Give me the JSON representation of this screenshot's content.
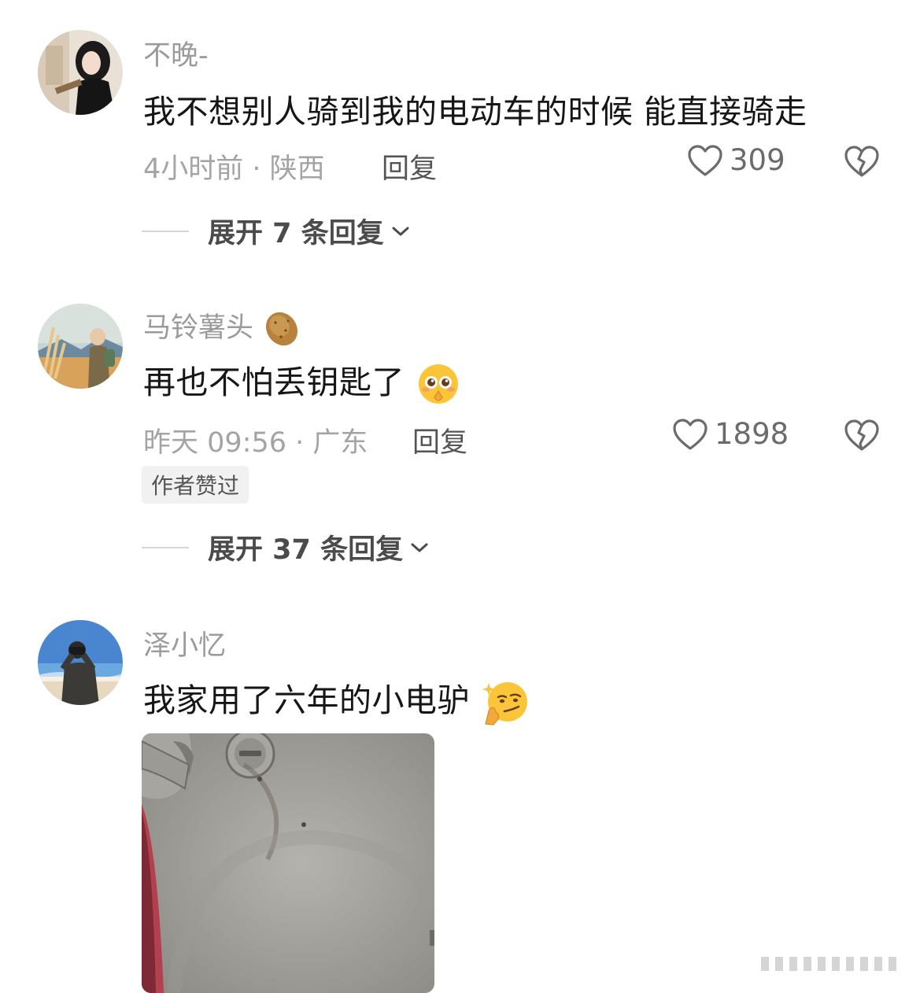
{
  "comments": [
    {
      "username": "不晚-",
      "username_emoji": "",
      "content": "我不想别人骑到我的电动车的时候  能直接骑走",
      "content_emoji": "",
      "meta": "4小时前 · 陕西",
      "reply_label": "回复",
      "likes": "309",
      "badge": "",
      "expand_label": "展开 7 条回复"
    },
    {
      "username": "马铃薯头",
      "username_emoji": "potato-icon",
      "content": "再也不怕丢钥匙了",
      "content_emoji": "pleading-face-icon",
      "meta": "昨天 09:56 · 广东",
      "reply_label": "回复",
      "likes": "1898",
      "badge": "作者赞过",
      "expand_label": "展开 37 条回复"
    },
    {
      "username": "泽小忆",
      "username_emoji": "",
      "content": "我家用了六年的小电驴",
      "content_emoji": "thinking-smirk-face-icon",
      "meta": "",
      "reply_label": "",
      "likes": "",
      "badge": "",
      "expand_label": ""
    }
  ],
  "colors": {
    "username": "#9b9b9b",
    "content": "#161616",
    "meta": "#a4a4a4",
    "reply": "#555555",
    "badge_bg": "#f1f1f1"
  }
}
